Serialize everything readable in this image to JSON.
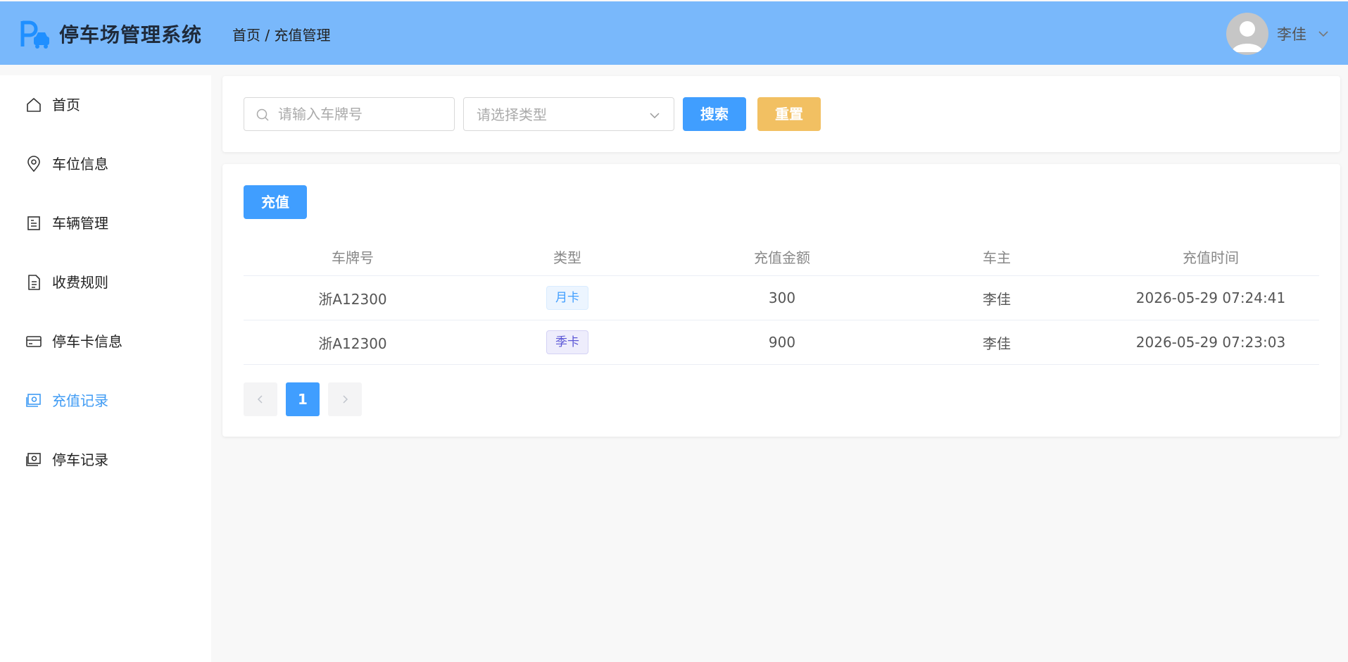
{
  "header": {
    "app_title": "停车场管理系统",
    "breadcrumb": "首页 / 充值管理",
    "username": "李佳"
  },
  "sidebar": {
    "items": [
      {
        "label": "首页",
        "icon": "home-icon"
      },
      {
        "label": "车位信息",
        "icon": "location-pin-icon"
      },
      {
        "label": "车辆管理",
        "icon": "document-icon"
      },
      {
        "label": "收费规则",
        "icon": "file-text-icon"
      },
      {
        "label": "停车卡信息",
        "icon": "credit-card-icon"
      },
      {
        "label": "充值记录",
        "icon": "money-icon",
        "active": true
      },
      {
        "label": "停车记录",
        "icon": "money-icon"
      }
    ]
  },
  "search": {
    "plate_placeholder": "请输入车牌号",
    "type_placeholder": "请选择类型",
    "search_label": "搜索",
    "reset_label": "重置"
  },
  "toolbar": {
    "recharge_label": "充值"
  },
  "table": {
    "columns": [
      "车牌号",
      "类型",
      "充值金额",
      "车主",
      "充值时间"
    ],
    "rows": [
      {
        "plate": "浙A12300",
        "type": "月卡",
        "amount": "300",
        "owner": "李佳",
        "time": "2026-05-29 07:24:41"
      },
      {
        "plate": "浙A12300",
        "type": "季卡",
        "amount": "900",
        "owner": "李佳",
        "time": "2026-05-29 07:23:03"
      }
    ]
  },
  "pagination": {
    "current_page": "1"
  },
  "colors": {
    "header_bg": "#79b8fb",
    "primary": "#409eff",
    "warning": "#f2c062",
    "active_nav": "#3f9bf4"
  }
}
